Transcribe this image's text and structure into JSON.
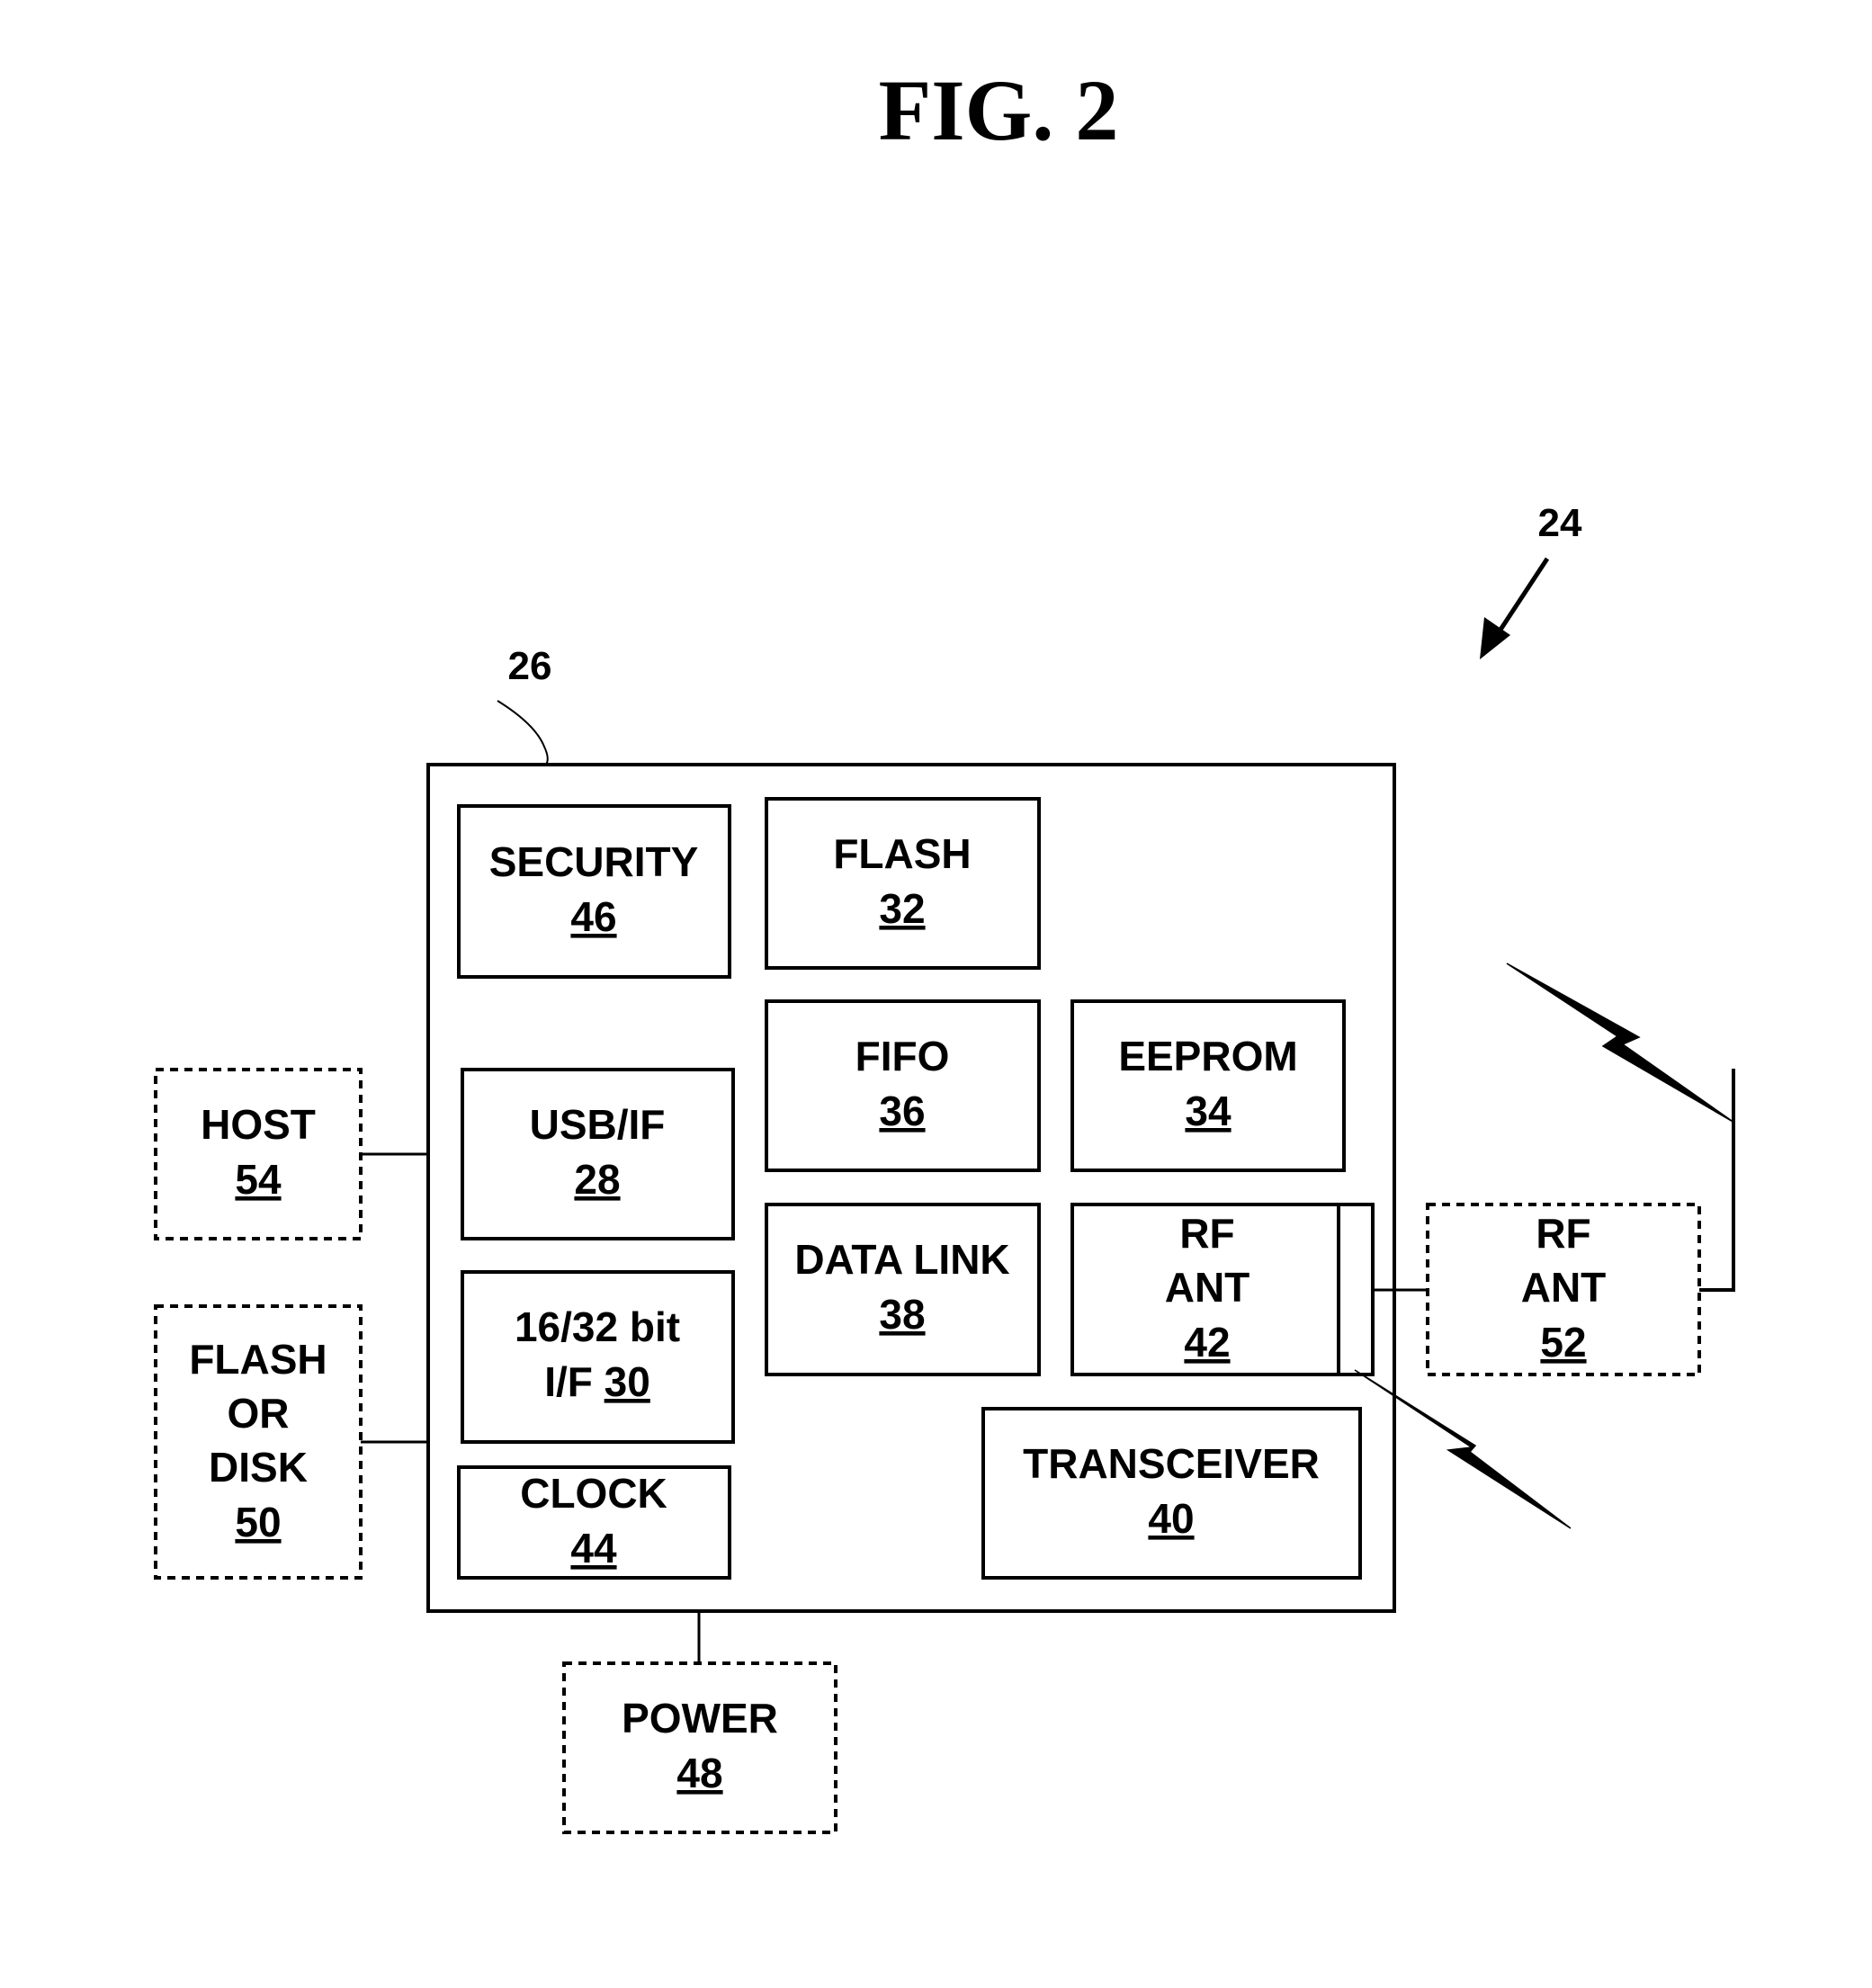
{
  "figure": {
    "title": "FIG. 2",
    "reference_device": "24",
    "reference_module": "26"
  },
  "internal_blocks": {
    "security": {
      "label": "SECURITY",
      "number": "46"
    },
    "flash": {
      "label": "FLASH",
      "number": "32"
    },
    "fifo": {
      "label": "FIFO",
      "number": "36"
    },
    "eeprom": {
      "label": "EEPROM",
      "number": "34"
    },
    "usb_if": {
      "label": "USB/IF",
      "number": "28"
    },
    "bit_if": {
      "label_line1": "16/32 bit",
      "label_line2": "I/F",
      "number": "30"
    },
    "clock": {
      "label": "CLOCK",
      "number": "44"
    },
    "data_link": {
      "label": "DATA LINK",
      "number": "38"
    },
    "rf_ant_internal": {
      "label_line1": "RF",
      "label_line2": "ANT",
      "number": "42"
    },
    "transceiver": {
      "label": "TRANSCEIVER",
      "number": "40"
    }
  },
  "external_blocks": {
    "host": {
      "label": "HOST",
      "number": "54"
    },
    "flash_or_disk": {
      "label_line1": "FLASH",
      "label_line2": "OR",
      "label_line3": "DISK",
      "number": "50"
    },
    "power": {
      "label": "POWER",
      "number": "48"
    },
    "rf_ant_external": {
      "label_line1": "RF",
      "label_line2": "ANT",
      "number": "52"
    }
  }
}
